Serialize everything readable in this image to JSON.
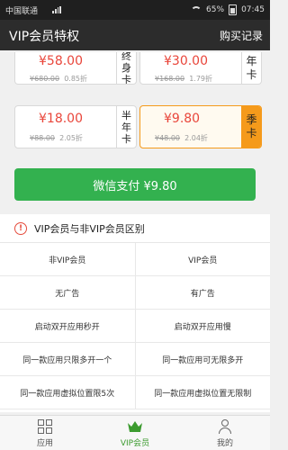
{
  "status_bar": {
    "carrier": "中国联通",
    "battery": "65%",
    "time": "07:45"
  },
  "header": {
    "title": "VIP会员特权",
    "records_label": "购买记录"
  },
  "packages": [
    {
      "price": "¥58.00",
      "original": "¥680.00",
      "discount": "0.85折",
      "label": "终身卡",
      "selected": false
    },
    {
      "price": "¥30.00",
      "original": "¥168.00",
      "discount": "1.79折",
      "label": "年卡",
      "selected": false
    },
    {
      "price": "¥18.00",
      "original": "¥88.00",
      "discount": "2.05折",
      "label": "半年卡",
      "selected": false
    },
    {
      "price": "¥9.80",
      "original": "¥48.00",
      "discount": "2.04折",
      "label": "季卡",
      "selected": true
    }
  ],
  "pay_button": {
    "label": "微信支付 ¥9.80"
  },
  "comparison": {
    "title": "VIP会员与非VIP会员区别",
    "header": [
      "非VIP会员",
      "VIP会员"
    ],
    "rows": [
      [
        "无广告",
        "有广告"
      ],
      [
        "启动双开应用秒开",
        "启动双开应用慢"
      ],
      [
        "同一款应用只限多开一个",
        "同一款应用可无限多开"
      ],
      [
        "同一款应用虚拟位置限5次",
        "同一款应用虚拟位置无限制"
      ]
    ]
  },
  "tabbar": {
    "items": [
      {
        "label": "应用",
        "icon": "grid-icon",
        "active": false
      },
      {
        "label": "VIP会员",
        "icon": "crown-icon",
        "active": true
      },
      {
        "label": "我的",
        "icon": "user-icon",
        "active": false
      }
    ]
  },
  "colors": {
    "accent_green": "#33b14f",
    "price_red": "#e9463b",
    "selected_orange": "#f59a1b"
  }
}
